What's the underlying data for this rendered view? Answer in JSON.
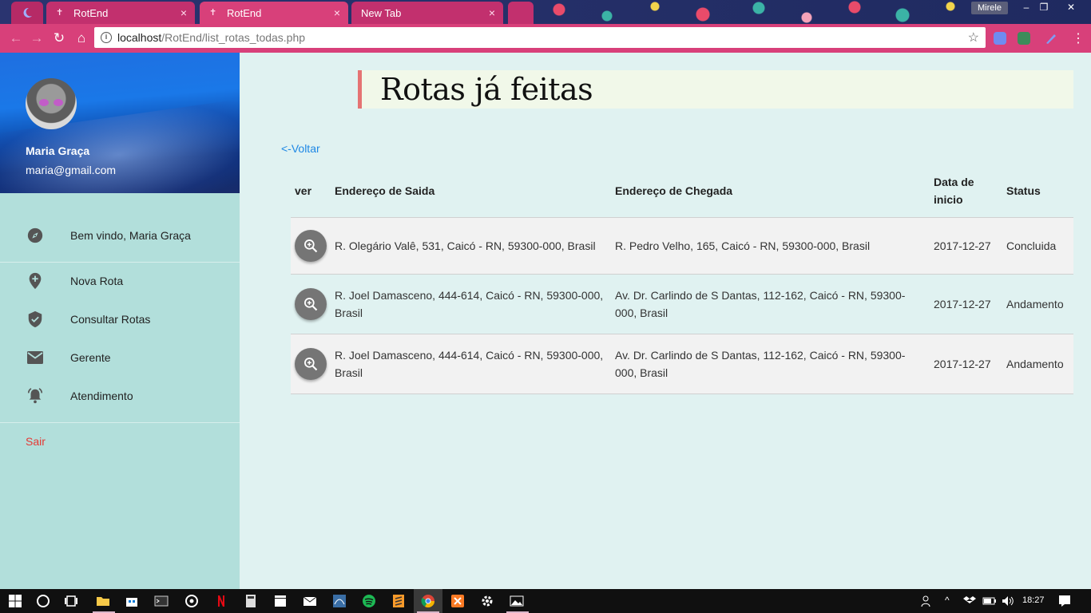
{
  "browser": {
    "tabs": [
      {
        "label": "RotEnd",
        "close": "×"
      },
      {
        "label": "RotEnd",
        "close": "×"
      },
      {
        "label": "New Tab",
        "close": "×"
      }
    ],
    "user": "Mirele",
    "url_host": "localhost",
    "url_path": "/RotEnd/list_rotas_todas.php",
    "window_controls": {
      "minimize": "–",
      "restore": "❐",
      "close": "✕"
    },
    "nav": {
      "back": "←",
      "forward": "→",
      "reload": "↻",
      "home": "⌂",
      "star": "☆",
      "menu": "⋮",
      "info": "i"
    }
  },
  "sidebar": {
    "user_name": "Maria Graça",
    "user_email": "maria@gmail.com",
    "items": [
      {
        "label": "Bem vindo, Maria Graça",
        "icon": "compass-icon"
      },
      {
        "label": "Nova Rota",
        "icon": "add-location-icon"
      },
      {
        "label": "Consultar Rotas",
        "icon": "verified-shield-icon"
      },
      {
        "label": "Gerente",
        "icon": "mail-icon"
      },
      {
        "label": "Atendimento",
        "icon": "alarm-bell-icon"
      }
    ],
    "logout": "Sair"
  },
  "main": {
    "title": "Rotas já feitas",
    "back": "<-Voltar",
    "columns": [
      "ver",
      "Endereço de Saida",
      "Endereço de Chegada",
      "Data de inicio",
      "Status"
    ],
    "rows": [
      {
        "saida": "R. Olegário Valê, 531, Caicó - RN, 59300-000, Brasil",
        "chegada": "R. Pedro Velho, 165, Caicó - RN, 59300-000, Brasil",
        "data": "2017-12-27",
        "status": "Concluida"
      },
      {
        "saida": "R. Joel Damasceno, 444-614, Caicó - RN, 59300-000, Brasil",
        "chegada": "Av. Dr. Carlindo de S Dantas, 112-162, Caicó - RN, 59300-000, Brasil",
        "data": "2017-12-27",
        "status": "Andamento"
      },
      {
        "saida": "R. Joel Damasceno, 444-614, Caicó - RN, 59300-000, Brasil",
        "chegada": "Av. Dr. Carlindo de S Dantas, 112-162, Caicó - RN, 59300-000, Brasil",
        "data": "2017-12-27",
        "status": "Andamento"
      }
    ]
  },
  "taskbar": {
    "clock": "18:27",
    "apps": [
      "windows-start-icon",
      "cortana-icon",
      "task-view-icon",
      "file-explorer-icon",
      "store-icon",
      "cmd-icon",
      "groove-icon",
      "netflix-icon",
      "calculator-icon",
      "movies-icon",
      "mail-icon",
      "mysql-icon",
      "spotify-icon",
      "sublime-icon",
      "chrome-icon",
      "xampp-icon",
      "settings-icon",
      "photos-icon"
    ]
  },
  "colors": {
    "accent_pink": "#d8407a",
    "sidebar_bg": "#b2dfdb",
    "main_bg": "#e0f2f1",
    "title_border": "#e57373",
    "link_blue": "#1e88e5",
    "logout_red": "#e53935"
  }
}
